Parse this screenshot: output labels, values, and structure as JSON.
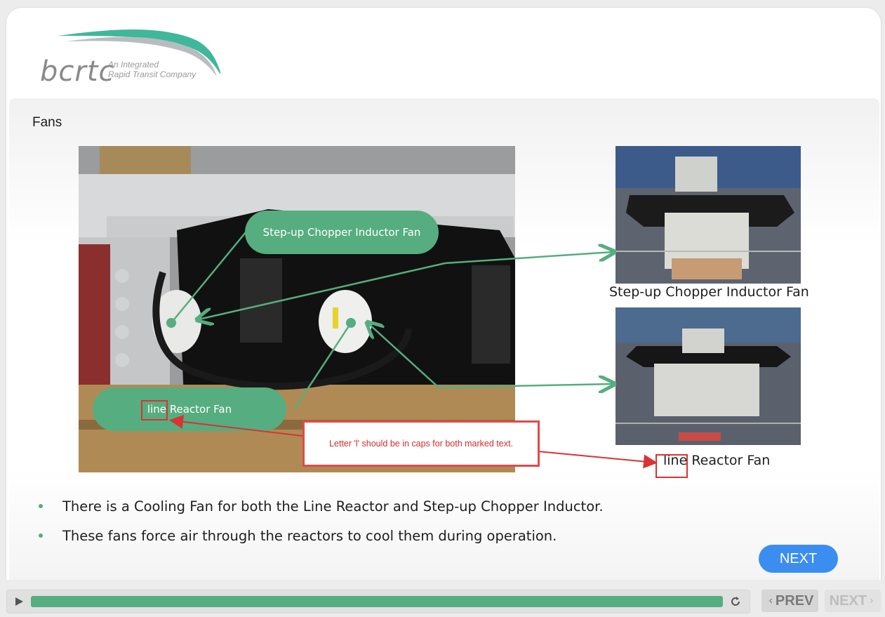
{
  "logo": {
    "word": "bcrtc",
    "tagline_1": "An Integrated",
    "tagline_2": "Rapid Transit Company"
  },
  "slide": {
    "title": "Fans",
    "callouts": {
      "chopper": "Step-up Chopper Inductor Fan",
      "reactor": "line Reactor Fan"
    },
    "captions": {
      "top": "Step-up Chopper Inductor Fan",
      "bottom_first": "line",
      "bottom_rest": " Reactor Fan"
    },
    "annotation_note": "Letter 'l' should be in caps for both marked text.",
    "bullets": [
      "There is a Cooling Fan for both the Line Reactor and Step-up Chopper Inductor.",
      "These fans force air through the reactors to cool them during operation."
    ],
    "next_label": "NEXT"
  },
  "player": {
    "progress": 1.0,
    "prev_label": "PREV",
    "next_label": "NEXT"
  },
  "colors": {
    "accent_green": "#56ad7f",
    "next_blue": "#3b8ef0",
    "annotation_red": "#d93333"
  }
}
